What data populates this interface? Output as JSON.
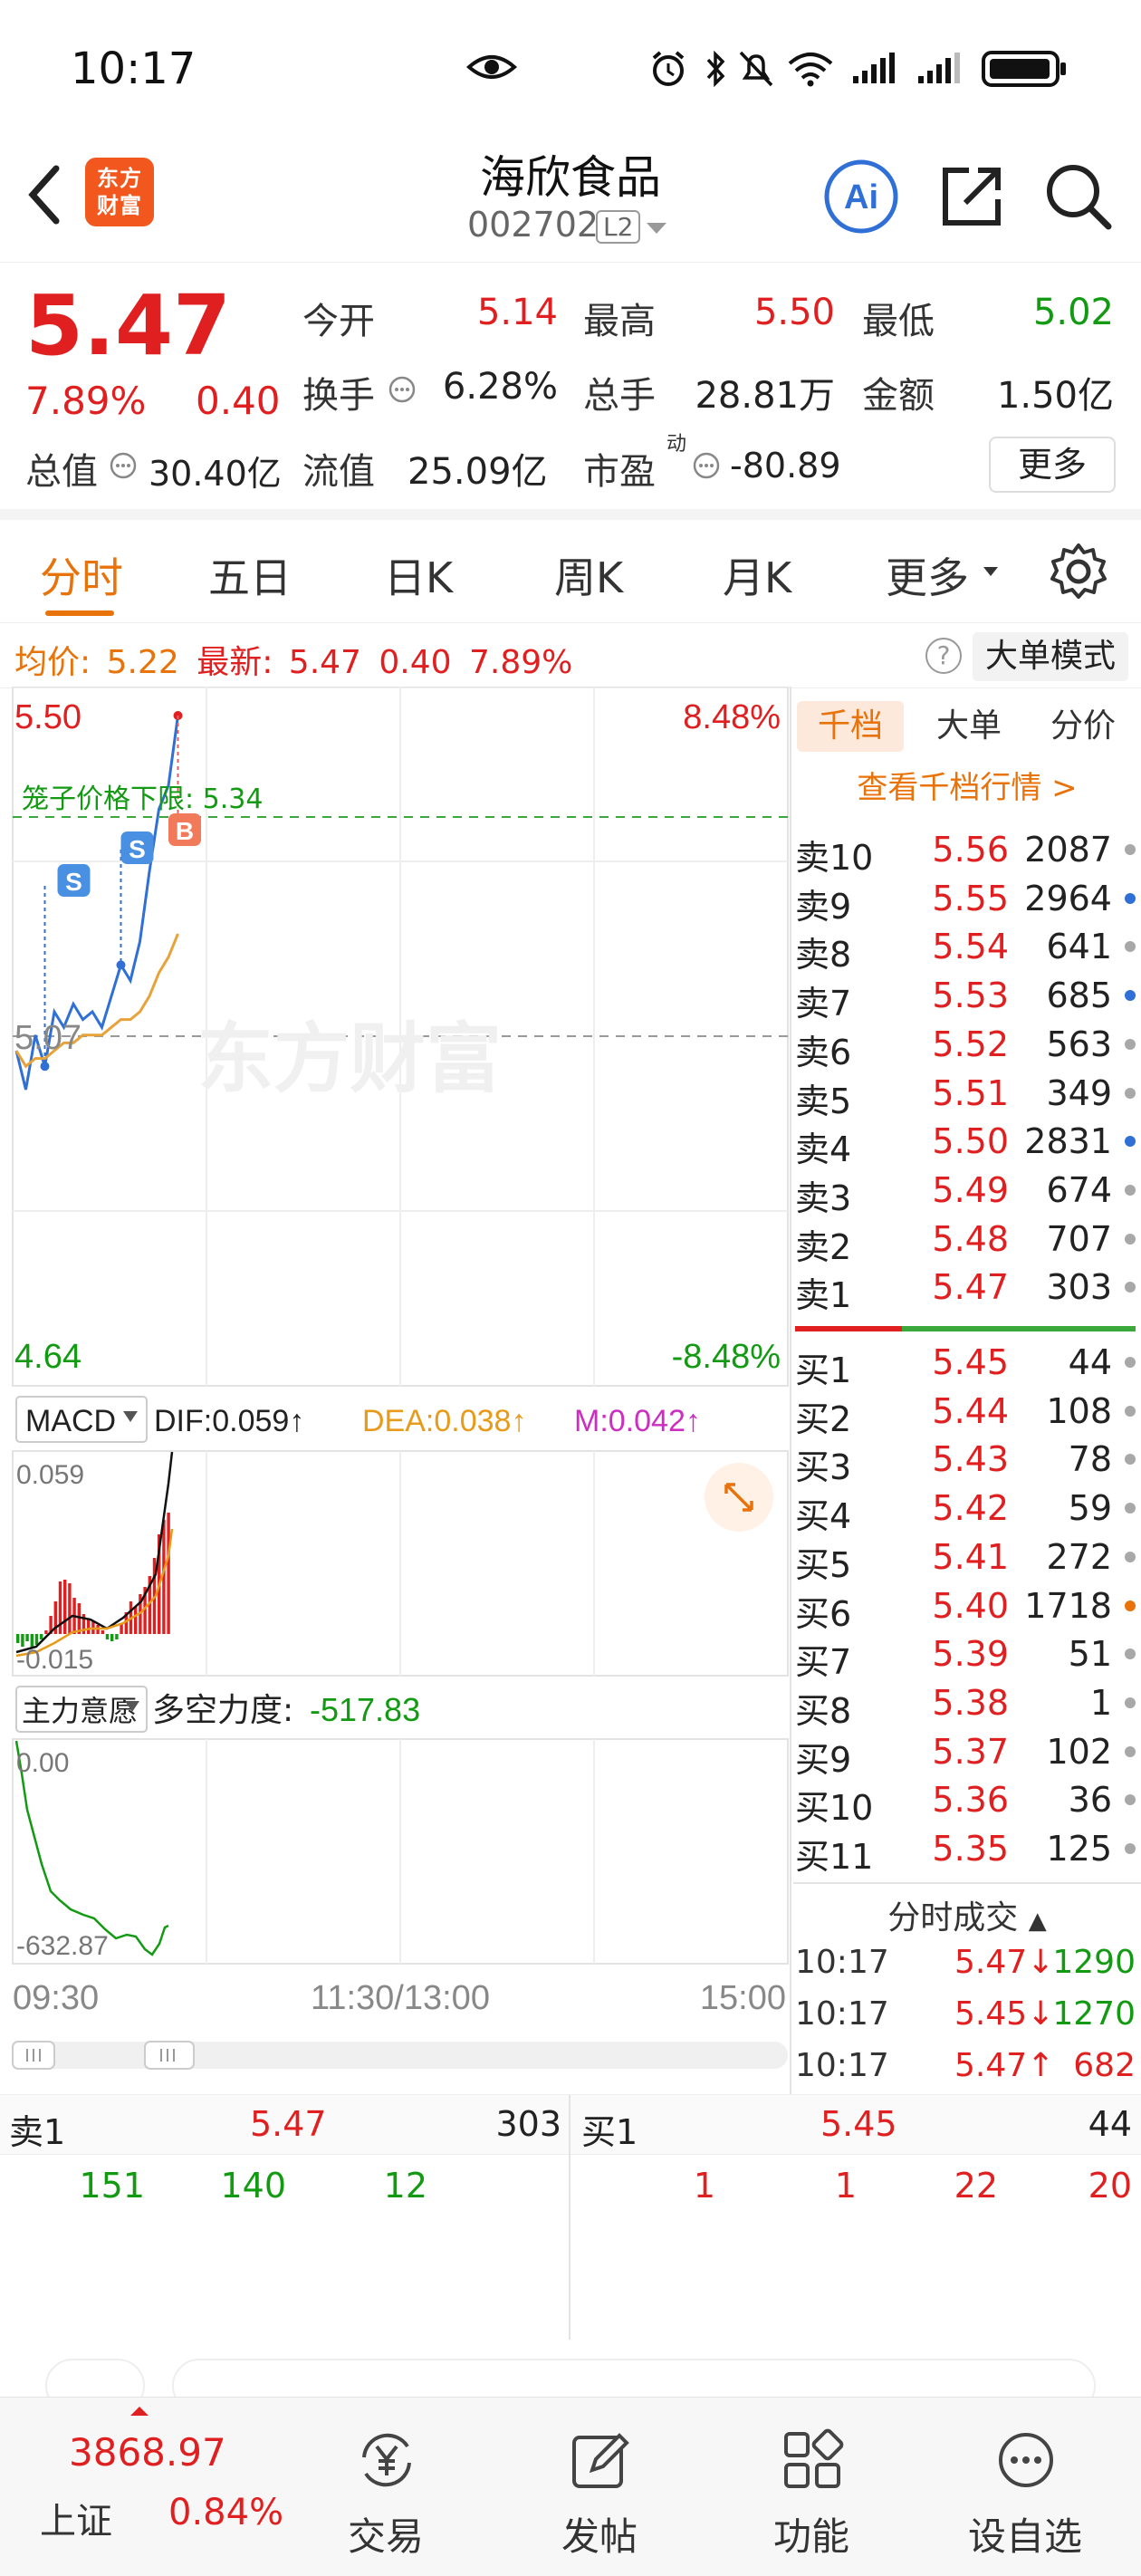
{
  "status_bar": {
    "time": "10:17"
  },
  "header": {
    "logo_text": "东方财富",
    "stock_name": "海欣食品",
    "stock_code": "002702",
    "level_badge": "L2"
  },
  "quote": {
    "price": "5.47",
    "change_pct": "7.89%",
    "change": "0.40",
    "open_label": "今开",
    "open_value": "5.14",
    "high_label": "最高",
    "high_value": "5.50",
    "low_label": "最低",
    "low_value": "5.02",
    "turnover_label": "换手",
    "turnover_value": "6.28%",
    "volume_label": "总手",
    "volume_value": "28.81万",
    "amount_label": "金额",
    "amount_value": "1.50亿",
    "mktcap_label": "总值",
    "mktcap_value": "30.40亿",
    "float_label": "流值",
    "float_value": "25.09亿",
    "pe_label": "市盈",
    "pe_sup": "动",
    "pe_value": "-80.89",
    "more_button": "更多"
  },
  "period_tabs": [
    "分时",
    "五日",
    "日K",
    "周K",
    "月K",
    "更多"
  ],
  "info_strip": {
    "avg_label": "均价:",
    "avg_value": "5.22",
    "latest_label": "最新:",
    "latest_value": "5.47",
    "latest_change": "0.40",
    "latest_pct": "7.89%",
    "help": "?",
    "big_order_mode": "大单模式"
  },
  "chart": {
    "price_top": "5.50",
    "pct_top": "8.48%",
    "price_prev_close": "5.07",
    "price_bottom": "4.64",
    "pct_bottom": "-8.48%",
    "cage_label": "笼子价格下限: 5.34",
    "watermark": "东方财富",
    "marker_s": "S",
    "marker_b": "B",
    "macd_label": "MACD",
    "dif": "DIF:0.059↑",
    "dea": "DEA:0.038↑",
    "m": "M:0.042↑",
    "macd_top": "0.059",
    "macd_bottom": "-0.015",
    "main_intent_label": "主力意愿",
    "force_label": "多空力度:",
    "force_value": "-517.83",
    "force_top": "0.00",
    "force_bottom": "-632.87",
    "time_start": "09:30",
    "time_mid": "11:30/13:00",
    "time_end": "15:00"
  },
  "chart_data": {
    "type": "line",
    "title": "",
    "x": [
      "09:30",
      "09:31",
      "09:32",
      "09:33",
      "09:34",
      "09:35",
      "09:36",
      "09:37",
      "09:38",
      "09:39",
      "09:40",
      "09:41",
      "09:42",
      "09:43",
      "09:44",
      "09:45",
      "09:46",
      "09:47"
    ],
    "series": [
      {
        "name": "",
        "values": [
          5.07,
          5.02,
          5.09,
          5.05,
          5.12,
          5.1,
          5.13,
          5.11,
          5.12,
          5.1,
          5.14,
          5.18,
          5.16,
          5.21,
          5.3,
          5.38,
          5.41,
          5.5
        ]
      },
      {
        "name": "均价",
        "values": [
          5.07,
          5.05,
          5.06,
          5.06,
          5.07,
          5.08,
          5.08,
          5.09,
          5.09,
          5.09,
          5.1,
          5.11,
          5.11,
          5.12,
          5.14,
          5.17,
          5.19,
          5.22
        ]
      }
    ],
    "ylim": [
      4.64,
      5.5
    ],
    "prev_close": 5.07
  },
  "order_book": {
    "tabs": [
      "千档",
      "大单",
      "分价"
    ],
    "view_link": "查看千档行情 >",
    "asks": [
      {
        "label": "卖10",
        "price": "5.56",
        "volume": "2087",
        "dot": "#a8a8a8"
      },
      {
        "label": "卖9",
        "price": "5.55",
        "volume": "2964",
        "dot": "#2f6fd6"
      },
      {
        "label": "卖8",
        "price": "5.54",
        "volume": "641",
        "dot": "#a8a8a8"
      },
      {
        "label": "卖7",
        "price": "5.53",
        "volume": "685",
        "dot": "#2f6fd6"
      },
      {
        "label": "卖6",
        "price": "5.52",
        "volume": "563",
        "dot": "#a8a8a8"
      },
      {
        "label": "卖5",
        "price": "5.51",
        "volume": "349",
        "dot": "#a8a8a8"
      },
      {
        "label": "卖4",
        "price": "5.50",
        "volume": "2831",
        "dot": "#2f6fd6"
      },
      {
        "label": "卖3",
        "price": "5.49",
        "volume": "674",
        "dot": "#a8a8a8"
      },
      {
        "label": "卖2",
        "price": "5.48",
        "volume": "707",
        "dot": "#a8a8a8"
      },
      {
        "label": "卖1",
        "price": "5.47",
        "volume": "303",
        "dot": "#a8a8a8"
      }
    ],
    "bids": [
      {
        "label": "买1",
        "price": "5.45",
        "volume": "44",
        "dot": "#a8a8a8"
      },
      {
        "label": "买2",
        "price": "5.44",
        "volume": "108",
        "dot": "#a8a8a8"
      },
      {
        "label": "买3",
        "price": "5.43",
        "volume": "78",
        "dot": "#a8a8a8"
      },
      {
        "label": "买4",
        "price": "5.42",
        "volume": "59",
        "dot": "#a8a8a8"
      },
      {
        "label": "买5",
        "price": "5.41",
        "volume": "272",
        "dot": "#a8a8a8"
      },
      {
        "label": "买6",
        "price": "5.40",
        "volume": "1718",
        "dot": "#e8730a"
      },
      {
        "label": "买7",
        "price": "5.39",
        "volume": "51",
        "dot": "#a8a8a8"
      },
      {
        "label": "买8",
        "price": "5.38",
        "volume": "1",
        "dot": "#a8a8a8"
      },
      {
        "label": "买9",
        "price": "5.37",
        "volume": "102",
        "dot": "#a8a8a8"
      },
      {
        "label": "买10",
        "price": "5.36",
        "volume": "36",
        "dot": "#a8a8a8"
      },
      {
        "label": "买11",
        "price": "5.35",
        "volume": "125",
        "dot": "#a8a8a8"
      }
    ],
    "ticks_title": "分时成交",
    "ticks": [
      {
        "time": "10:17",
        "price": "5.47↓",
        "volume": "1290",
        "color": "#e02020",
        "vcolor": "#129a12"
      },
      {
        "time": "10:17",
        "price": "5.45↓",
        "volume": "1270",
        "color": "#e02020",
        "vcolor": "#129a12"
      },
      {
        "time": "10:17",
        "price": "5.47↑",
        "volume": "682",
        "color": "#e02020",
        "vcolor": "#e02020"
      }
    ]
  },
  "level1": {
    "ask_label": "卖1",
    "ask_price": "5.47",
    "ask_volume": "303",
    "bid_label": "买1",
    "bid_price": "5.45",
    "bid_volume": "44",
    "ask_queue": [
      "151",
      "140",
      "12"
    ],
    "bid_queue": [
      "1",
      "1",
      "22",
      "20"
    ]
  },
  "bottom_nav": {
    "index_value": "3868.97",
    "index_name": "上证",
    "index_pct": "0.84%",
    "items": [
      "交易",
      "发帖",
      "功能",
      "设自选"
    ]
  },
  "colors": {
    "up": "#e02020",
    "down": "#129a12",
    "accent": "#e8730a",
    "blue": "#2f6fd6"
  }
}
